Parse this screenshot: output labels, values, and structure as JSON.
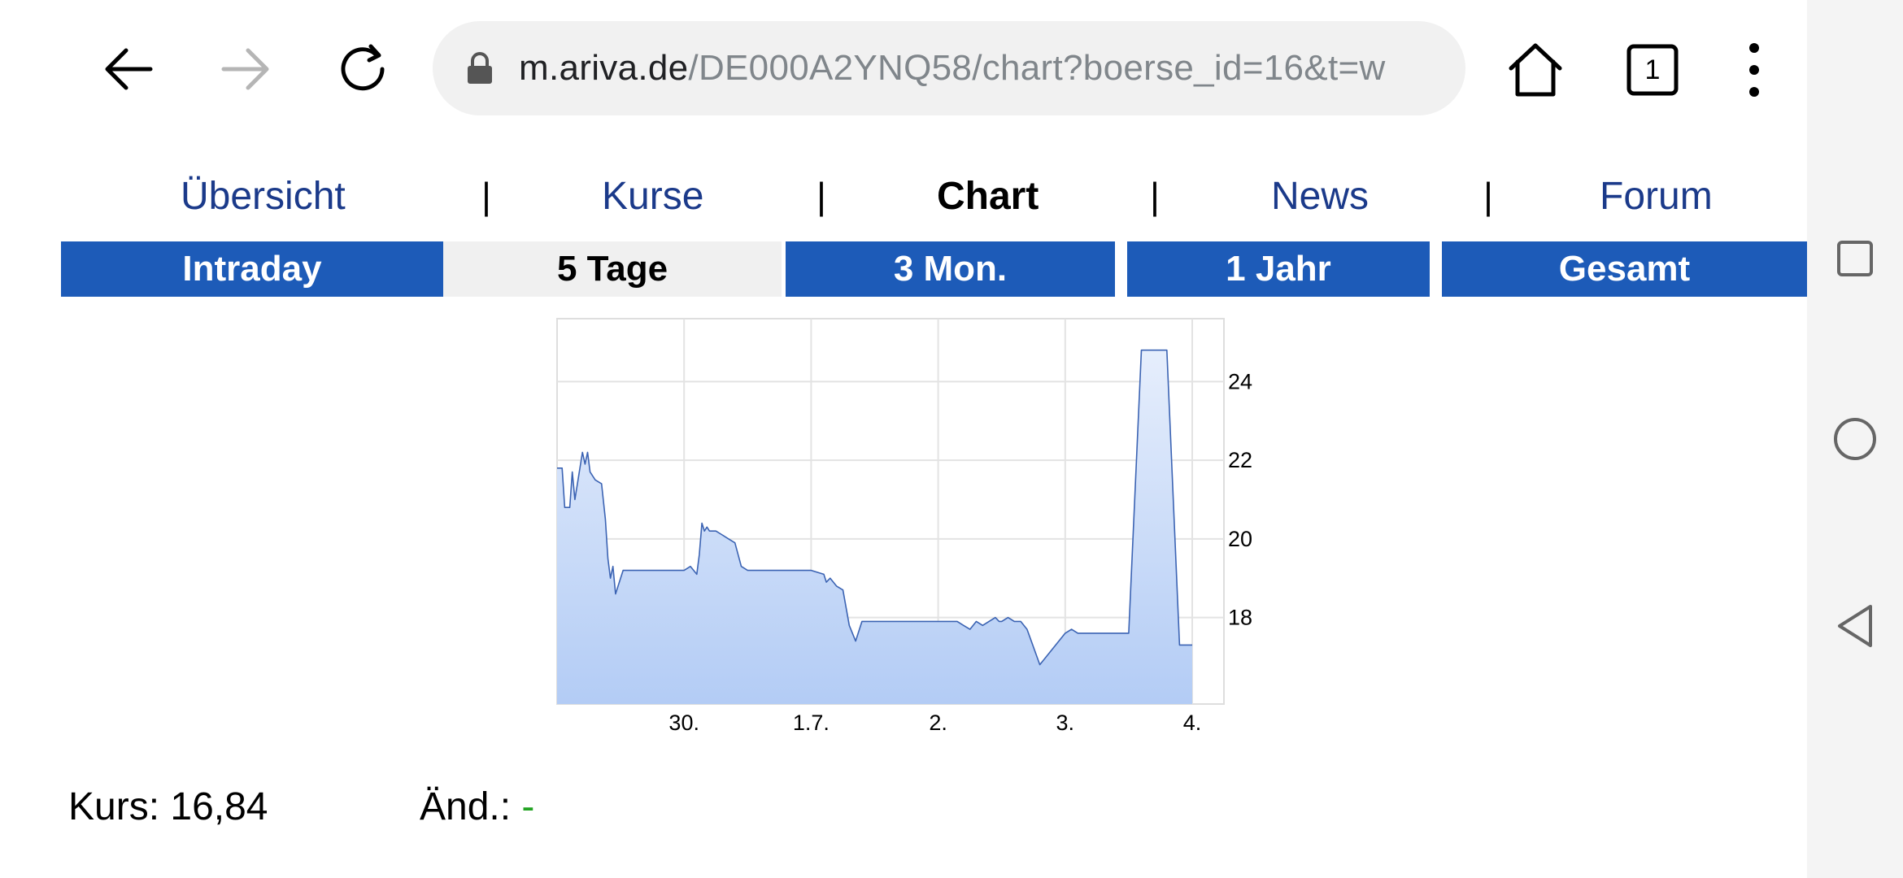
{
  "browser": {
    "url_host": "m.ariva.de",
    "url_path": "/DE000A2YNQ58/chart?boerse_id=16&t=w",
    "tab_count": "1"
  },
  "nav": {
    "items": [
      {
        "label": "Übersicht"
      },
      {
        "label": "Kurse"
      },
      {
        "label": "Chart"
      },
      {
        "label": "News"
      },
      {
        "label": "Forum"
      }
    ],
    "separator": "|",
    "active_label": "Chart"
  },
  "ranges": {
    "items": [
      {
        "label": "Intraday"
      },
      {
        "label": "5 Tage"
      },
      {
        "label": "3 Mon."
      },
      {
        "label": "1 Jahr"
      },
      {
        "label": "Gesamt"
      }
    ],
    "active_label": "5 Tage"
  },
  "quote": {
    "kurs_label": "Kurs: 16,84",
    "change_label": "Änd.:",
    "change_value": "-"
  },
  "colors": {
    "nav_link": "#1b3a8a",
    "range_button": "#1d5bb8",
    "range_active_bg": "#f0f0f0",
    "chart_line": "#3b63b3",
    "chart_fill_top": "#e6eefc",
    "chart_fill_bottom": "#b3ccf5",
    "change_positive": "#22a322"
  },
  "chart_data": {
    "type": "area",
    "x_tick_labels": [
      "30.",
      "1.7.",
      "2.",
      "3.",
      "4."
    ],
    "y_ticks": [
      18,
      20,
      22,
      24
    ],
    "ylim": [
      15.8,
      25.6
    ],
    "xlim": [
      0,
      5
    ],
    "grid": true,
    "series": [
      {
        "x": [
          0,
          0.04,
          0.06,
          0.1,
          0.12,
          0.14,
          0.16,
          0.2,
          0.22,
          0.24,
          0.26,
          0.3,
          0.35,
          0.38,
          0.4,
          0.42,
          0.44,
          0.46,
          0.5,
          0.52,
          0.54,
          0.56,
          0.6,
          0.65,
          0.7,
          0.75,
          0.8,
          0.9,
          1.0,
          1.05,
          1.1,
          1.12,
          1.14,
          1.16,
          1.18,
          1.2,
          1.25,
          1.3,
          1.35,
          1.4,
          1.45,
          1.5,
          1.55,
          1.6,
          1.62,
          1.65,
          1.7,
          1.75,
          1.8,
          1.9,
          2.0,
          2.1,
          2.12,
          2.15,
          2.2,
          2.25,
          2.3,
          2.35,
          2.4,
          2.45,
          2.5,
          2.55,
          2.6,
          2.65,
          2.7,
          2.72,
          2.75,
          2.8,
          2.9,
          3.0,
          3.05,
          3.1,
          3.15,
          3.2,
          3.25,
          3.3,
          3.35,
          3.4,
          3.45,
          3.48,
          3.5,
          3.55,
          3.6,
          3.65,
          3.7,
          3.8,
          3.9,
          4.0,
          4.05,
          4.1,
          4.12,
          4.14,
          4.16,
          4.18,
          4.2,
          4.25,
          4.3,
          4.35,
          4.4,
          4.45,
          4.48,
          4.5,
          4.6,
          4.7,
          4.8,
          4.9,
          5.0
        ],
        "y": [
          21.8,
          21.8,
          20.8,
          20.8,
          21.7,
          21.0,
          21.4,
          22.2,
          21.9,
          22.2,
          21.7,
          21.5,
          21.4,
          20.5,
          19.5,
          19.0,
          19.3,
          18.6,
          19.0,
          19.2,
          19.2,
          19.2,
          19.2,
          19.2,
          19.2,
          19.2,
          19.2,
          19.2,
          19.2,
          19.3,
          19.1,
          19.6,
          20.4,
          20.2,
          20.3,
          20.2,
          20.2,
          20.1,
          20.0,
          19.9,
          19.3,
          19.2,
          19.2,
          19.2,
          19.2,
          19.2,
          19.2,
          19.2,
          19.2,
          19.2,
          19.2,
          19.1,
          18.9,
          19.0,
          18.8,
          18.7,
          17.8,
          17.4,
          17.9,
          17.9,
          17.9,
          17.9,
          17.9,
          17.9,
          17.9,
          17.9,
          17.9,
          17.9,
          17.9,
          17.9,
          17.9,
          17.9,
          17.9,
          17.8,
          17.7,
          17.9,
          17.8,
          17.9,
          18.0,
          17.9,
          17.9,
          18.0,
          17.9,
          17.9,
          17.7,
          16.8,
          17.2,
          17.6,
          17.7,
          17.6,
          17.6,
          17.6,
          17.6,
          17.6,
          17.6,
          17.6,
          17.6,
          17.6,
          17.6,
          17.6,
          17.6,
          17.6,
          24.8,
          24.8,
          24.8,
          17.3,
          17.3
        ]
      }
    ],
    "notes": "x position in trading days from start of window"
  }
}
